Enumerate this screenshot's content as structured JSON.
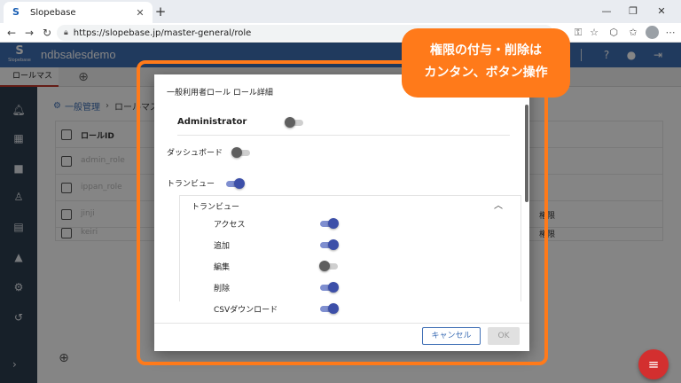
{
  "browser": {
    "tab_title": "Slopebase",
    "url": "https://slopebase.jp/master-general/role"
  },
  "app": {
    "logo_text": "Slopebase",
    "name": "ndbsalesdemo",
    "tab_label": "ロールマスタ"
  },
  "breadcrumb": {
    "link": "一般管理",
    "current": "ロールマスタ"
  },
  "table": {
    "header": "ロールID",
    "rows": [
      {
        "id": "admin_role",
        "right": ""
      },
      {
        "id": "ippan_role",
        "right": ""
      },
      {
        "id": "jinji",
        "right": "権限"
      },
      {
        "id": "keiri",
        "right": "権限"
      }
    ]
  },
  "dialog": {
    "title": "一般利用者ロール ロール詳細",
    "administrator": {
      "label": "Administrator",
      "on": false
    },
    "dashboard": {
      "label": "ダッシュボード",
      "on": false
    },
    "tranview": {
      "label": "トランビュー",
      "on": true
    },
    "section_title": "トランビュー",
    "permissions": [
      {
        "label": "アクセス",
        "on": true
      },
      {
        "label": "追加",
        "on": true
      },
      {
        "label": "編集",
        "on": false
      },
      {
        "label": "削除",
        "on": true
      },
      {
        "label": "CSVダウンロード",
        "on": true
      }
    ],
    "cancel_label": "キャンセル",
    "ok_label": "OK"
  },
  "annotation": {
    "line1": "権限の付与・削除は",
    "line2": "カンタン、ボタン操作"
  },
  "colors": {
    "header": "#3f6fb5",
    "sidebar": "#2c3e50",
    "accent_orange": "#ff7a1a",
    "toggle_on": "#3c4fa8",
    "fab": "#d32f2f"
  }
}
